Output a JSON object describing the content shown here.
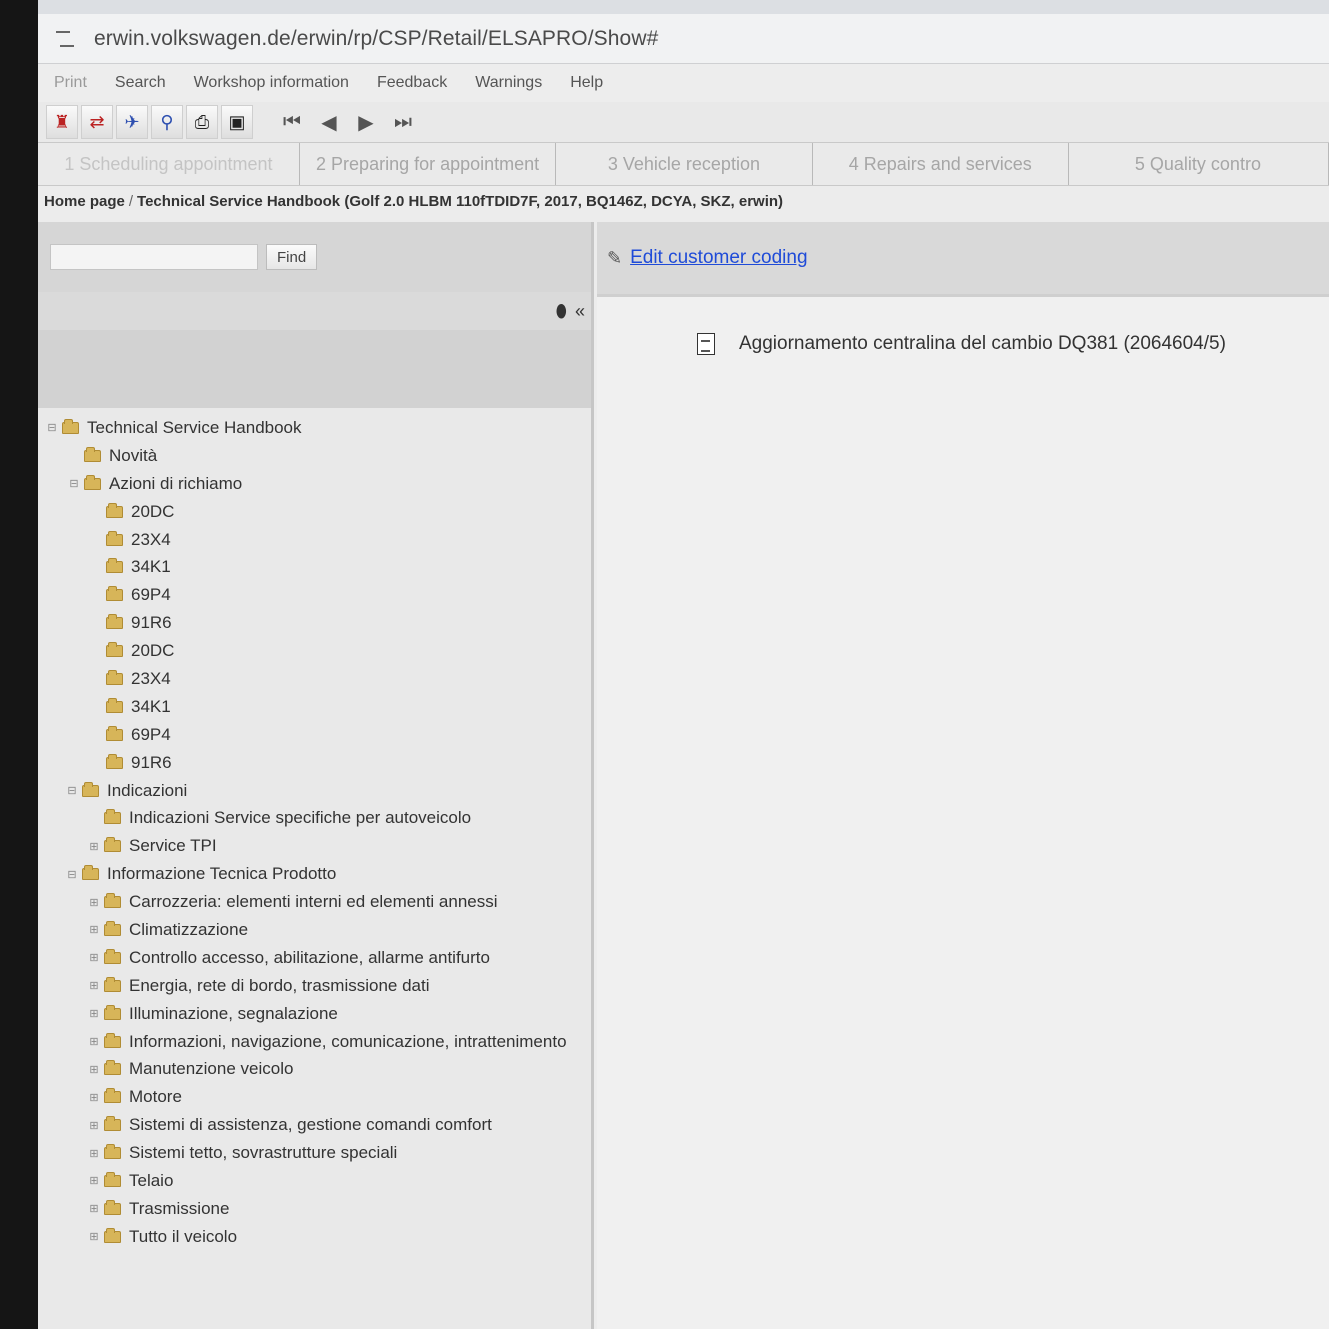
{
  "browser": {
    "url": "erwin.volkswagen.de/erwin/rp/CSP/Retail/ELSAPRO/Show#"
  },
  "menu": [
    {
      "label": "Print"
    },
    {
      "label": "Search"
    },
    {
      "label": "Workshop information"
    },
    {
      "label": "Feedback"
    },
    {
      "label": "Warnings"
    },
    {
      "label": "Help"
    }
  ],
  "toolbar_icons": [
    "user-icon",
    "swap-icon",
    "map-icon",
    "magnifier-icon",
    "printer-icon",
    "save-icon"
  ],
  "nav_icons": [
    "first-icon",
    "previous-icon",
    "next-icon",
    "last-icon"
  ],
  "steps": [
    "1 Scheduling appointment",
    "2 Preparing for appointment",
    "3 Vehicle reception",
    "4 Repairs and services",
    "5 Quality contro"
  ],
  "breadcrumb": {
    "home": "Home page",
    "separator": "/",
    "current": "Technical Service Handbook (Golf 2.0 HLBM 110fTDID7F, 2017, BQ146Z, DCYA, SKZ, erwin)"
  },
  "search": {
    "button": "Find",
    "value": ""
  },
  "tree": [
    {
      "label": "Technical Service Handbook",
      "exp": "⊟"
    },
    {
      "label": "Novità",
      "exp": ""
    },
    {
      "label": "Azioni di richiamo",
      "exp": "⊟"
    },
    {
      "label": "20DC",
      "exp": ""
    },
    {
      "label": "23X4",
      "exp": ""
    },
    {
      "label": "34K1",
      "exp": ""
    },
    {
      "label": "69P4",
      "exp": ""
    },
    {
      "label": "91R6",
      "exp": ""
    },
    {
      "label": "20DC",
      "exp": ""
    },
    {
      "label": "23X4",
      "exp": ""
    },
    {
      "label": "34K1",
      "exp": ""
    },
    {
      "label": "69P4",
      "exp": ""
    },
    {
      "label": "91R6",
      "exp": ""
    },
    {
      "label": "Indicazioni",
      "exp": "⊟"
    },
    {
      "label": "Indicazioni Service specifiche per autoveicolo",
      "exp": ""
    },
    {
      "label": "Service TPI",
      "exp": "⊞"
    },
    {
      "label": "Informazione Tecnica Prodotto",
      "exp": "⊟"
    },
    {
      "label": "Carrozzeria: elementi interni ed elementi annessi",
      "exp": "⊞"
    },
    {
      "label": "Climatizzazione",
      "exp": "⊞"
    },
    {
      "label": "Controllo accesso, abilitazione, allarme antifurto",
      "exp": "⊞"
    },
    {
      "label": "Energia, rete di bordo, trasmissione dati",
      "exp": "⊞"
    },
    {
      "label": "Illuminazione, segnalazione",
      "exp": "⊞"
    },
    {
      "label": "Informazioni, navigazione, comunicazione, intrattenimento",
      "exp": "⊞"
    },
    {
      "label": "Manutenzione veicolo",
      "exp": "⊞"
    },
    {
      "label": "Motore",
      "exp": "⊞"
    },
    {
      "label": "Sistemi di assistenza, gestione comandi comfort",
      "exp": "⊞"
    },
    {
      "label": "Sistemi tetto, sovrastrutture speciali",
      "exp": "⊞"
    },
    {
      "label": "Telaio",
      "exp": "⊞"
    },
    {
      "label": "Trasmissione",
      "exp": "⊞"
    },
    {
      "label": "Tutto il veicolo",
      "exp": "⊞"
    }
  ],
  "right": {
    "link": "Edit customer coding",
    "document": "Aggiornamento centralina del cambio DQ381 (2064604/5)"
  }
}
